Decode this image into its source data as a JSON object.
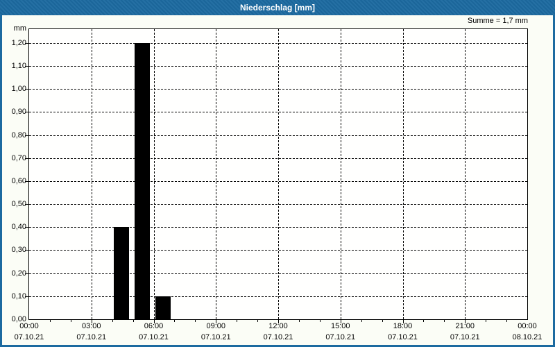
{
  "window": {
    "title": "Niederschlag [mm]",
    "colors": {
      "titlebar_bg": "#1c6aa0",
      "titlebar_text": "#ffffff",
      "window_border": "#1c6aa0",
      "content_bg": "#fbfdf6",
      "plot_bg": "#fffffe",
      "grid_color": "#000000",
      "bar_color": "#000000",
      "label_color": "#000000"
    }
  },
  "summary": {
    "label": "Summe = 1,7 mm"
  },
  "chart_data": {
    "type": "bar",
    "title": "Niederschlag [mm]",
    "ylabel": "mm",
    "sum_annotation": "Summe = 1,7 mm",
    "series_name": "Niederschlag",
    "x_hours": [
      4,
      5,
      6
    ],
    "values": [
      0.4,
      1.2,
      0.1
    ],
    "sum_mm": 1.7,
    "xlim_hours": [
      0,
      24
    ],
    "ylim": [
      0,
      1.26
    ],
    "grid": "dashed",
    "legend": "none",
    "bar_color": "#000000",
    "y_ticks": [
      0,
      0.1,
      0.2,
      0.3,
      0.4,
      0.5,
      0.6,
      0.7,
      0.8,
      0.9,
      1.0,
      1.1,
      1.2
    ],
    "y_tick_labels": [
      "0,00",
      "0,10",
      "0,20",
      "0,30",
      "0,40",
      "0,50",
      "0,60",
      "0,70",
      "0,80",
      "0,90",
      "1,00",
      "1,10",
      "1,20"
    ],
    "x_gridline_hours": [
      3,
      6,
      9,
      12,
      15,
      18,
      21
    ],
    "x_minor_tick_interval_hours": 1,
    "x_major_ticks": [
      {
        "hour": 0,
        "time": "00:00",
        "date": "07.10.21"
      },
      {
        "hour": 3,
        "time": "03:00",
        "date": "07.10.21"
      },
      {
        "hour": 6,
        "time": "06:00",
        "date": "07.10.21"
      },
      {
        "hour": 9,
        "time": "09:00",
        "date": "07.10.21"
      },
      {
        "hour": 12,
        "time": "12:00",
        "date": "07.10.21"
      },
      {
        "hour": 15,
        "time": "15:00",
        "date": "07.10.21"
      },
      {
        "hour": 18,
        "time": "18:00",
        "date": "07.10.21"
      },
      {
        "hour": 21,
        "time": "21:00",
        "date": "07.10.21"
      },
      {
        "hour": 24,
        "time": "00:00",
        "date": "08.10.21"
      }
    ]
  }
}
